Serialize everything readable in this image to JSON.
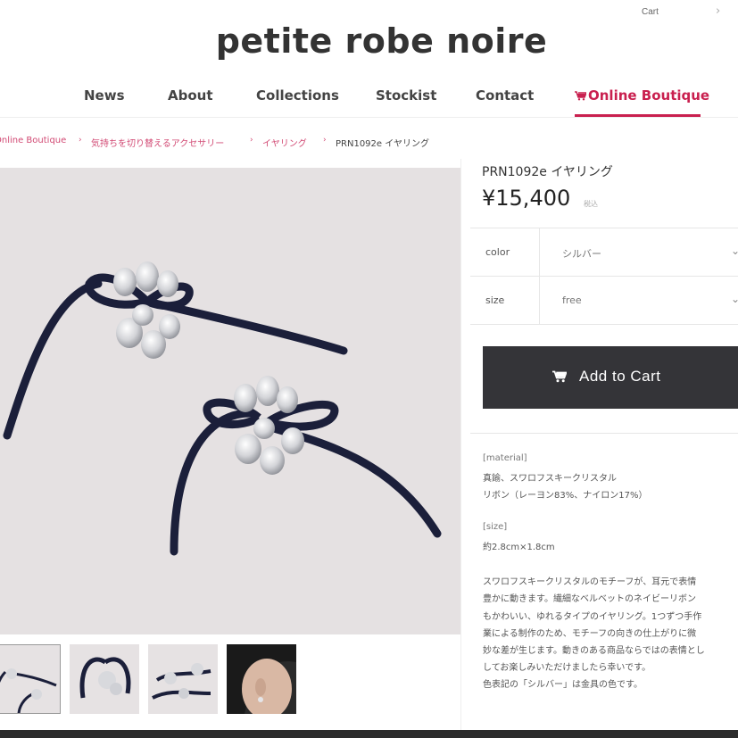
{
  "header": {
    "cart_label": "Cart",
    "brand": "petite robe noire"
  },
  "nav": {
    "items": [
      "News",
      "About",
      "Collections",
      "Stockist",
      "Contact",
      "Online Boutique"
    ],
    "active_color": "#c9204f"
  },
  "breadcrumb": {
    "items": [
      "Online Boutique",
      "気持ちを切り替えるアクセサリー",
      "イヤリング",
      "PRN1092e イヤリング"
    ],
    "separator": "›"
  },
  "product": {
    "title": "PRN1092e イヤリング",
    "price": "¥15,400",
    "tax_note": "税込"
  },
  "options": [
    {
      "label": "color",
      "value": "シルバー"
    },
    {
      "label": "size",
      "value": "free"
    }
  ],
  "add_to_cart": {
    "label": "Add to Cart",
    "bg_color": "#343438"
  },
  "description": {
    "material_heading": "[material]",
    "material_lines": [
      "真鍮、スワロフスキークリスタル",
      "リボン（レーヨン83%、ナイロン17%）"
    ],
    "size_heading": "[size]",
    "size_value": "約2.8cm×1.8cm",
    "body_lines": [
      "スワロフスキークリスタルのモチーフが、耳元で表情",
      "豊かに動きます。繊細なベルベットのネイビーリボン",
      "もかわいい、ゆれるタイプのイヤリング。1つずつ手作",
      "業による制作のため、モチーフの向きの仕上がりに微",
      "妙な差が生じます。動きのある商品ならではの表情とし",
      "してお楽しみいただけましたら幸いです。",
      "色表記の「シルバー」は金具の色です。"
    ]
  },
  "icons": {
    "cart": "cart-icon",
    "caret": "chevron-down-icon",
    "chevron": "chevron-right-icon"
  }
}
